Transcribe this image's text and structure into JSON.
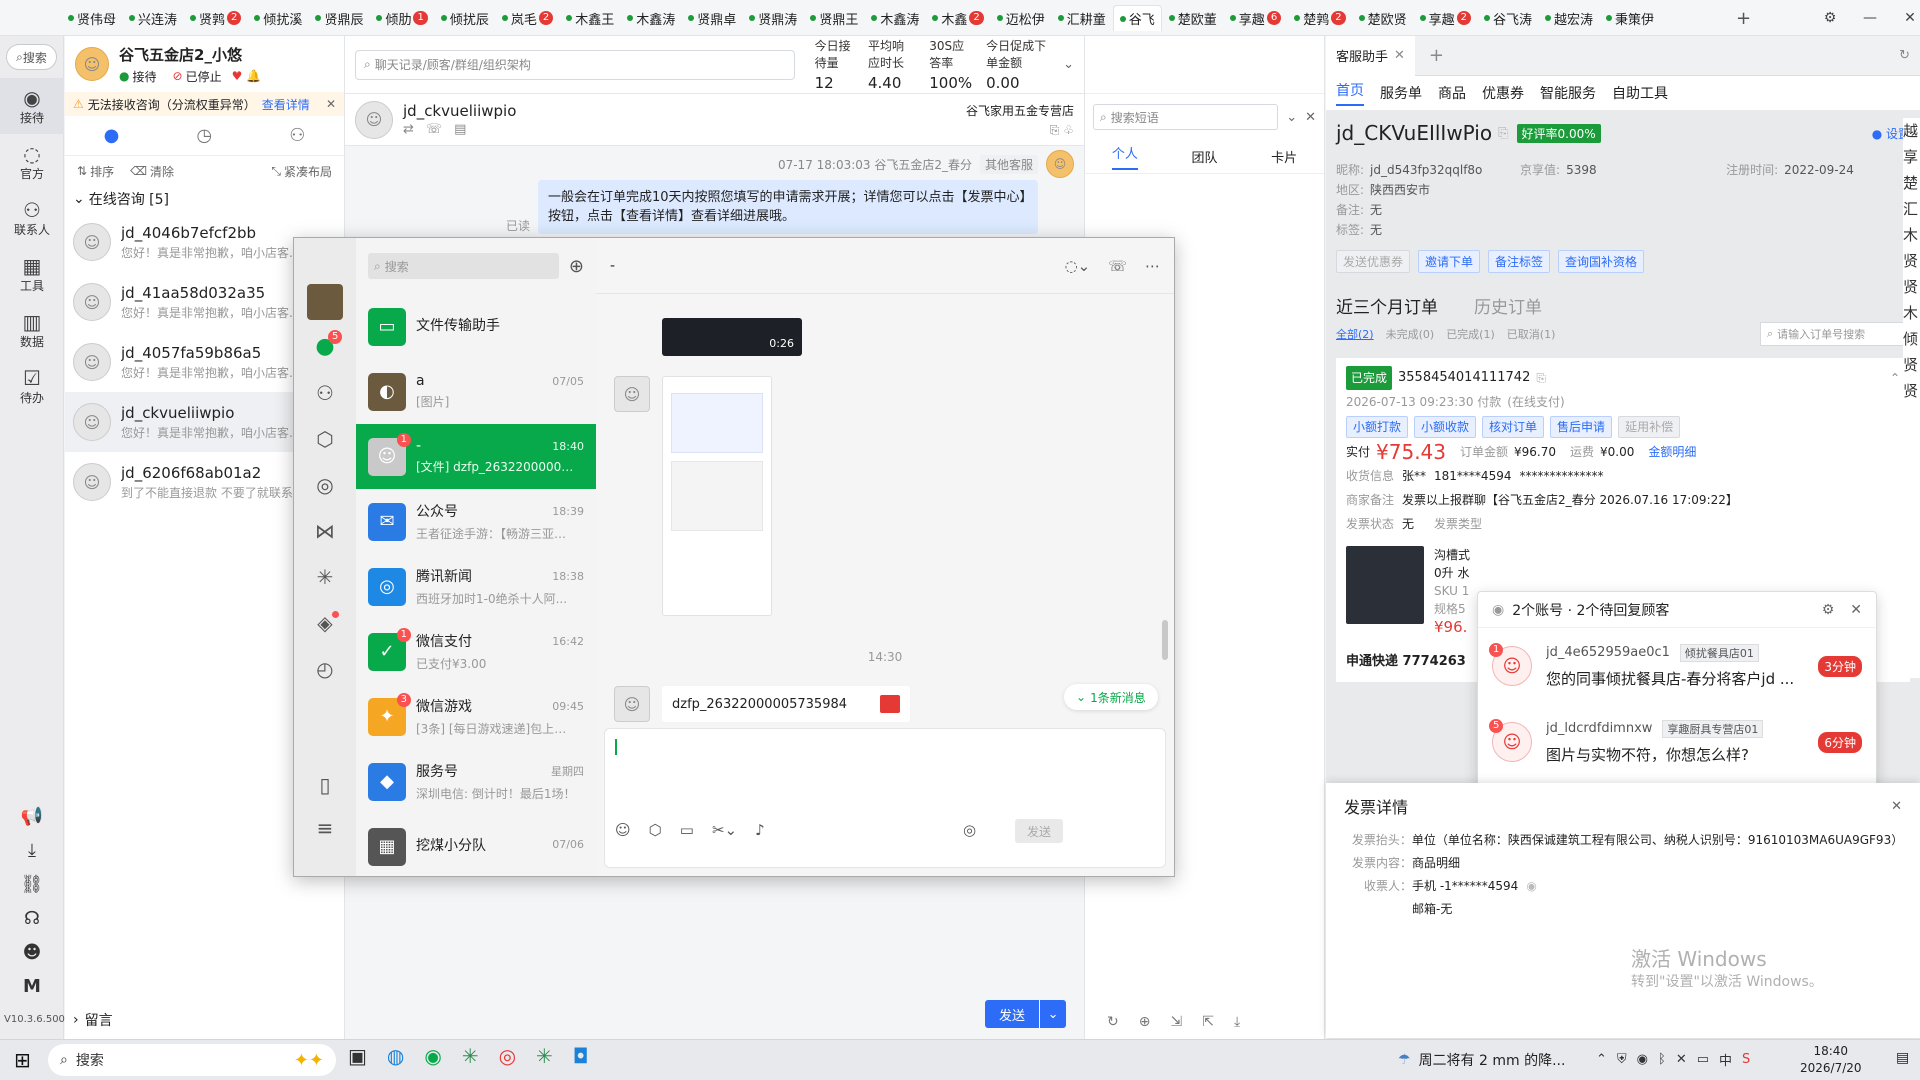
{
  "tabs": [
    {
      "label": "贤伟母",
      "badge": ""
    },
    {
      "label": "兴连涛",
      "badge": ""
    },
    {
      "label": "贤鹑",
      "badge": "2"
    },
    {
      "label": "倾扰溪",
      "badge": ""
    },
    {
      "label": "贤鼎辰",
      "badge": ""
    },
    {
      "label": "倾肋",
      "badge": "1"
    },
    {
      "label": "倾扰辰",
      "badge": ""
    },
    {
      "label": "岚毛",
      "badge": "2"
    },
    {
      "label": "木鑫王",
      "badge": ""
    },
    {
      "label": "木鑫涛",
      "badge": ""
    },
    {
      "label": "贤鼎卓",
      "badge": ""
    },
    {
      "label": "贤鼎涛",
      "badge": ""
    },
    {
      "label": "贤鼎王",
      "badge": ""
    },
    {
      "label": "木鑫涛",
      "badge": ""
    },
    {
      "label": "木鑫",
      "badge": "2"
    },
    {
      "label": "迈松伊",
      "badge": ""
    },
    {
      "label": "汇耕童",
      "badge": ""
    },
    {
      "label": "谷飞",
      "badge": "",
      "active": true
    },
    {
      "label": "楚欧董",
      "badge": ""
    },
    {
      "label": "享趣",
      "badge": "6"
    },
    {
      "label": "楚鹑",
      "badge": "2"
    },
    {
      "label": "楚欧贤",
      "badge": ""
    },
    {
      "label": "享趣",
      "badge": "2"
    },
    {
      "label": "谷飞涛",
      "badge": ""
    },
    {
      "label": "越宏涛",
      "badge": ""
    },
    {
      "label": "秉策伊",
      "badge": ""
    }
  ],
  "rail": {
    "search": "搜索",
    "items": [
      "接待",
      "官方",
      "联系人",
      "工具",
      "数据",
      "待办"
    ],
    "version": "V10.3.6.500"
  },
  "shop": {
    "name": "谷飞五金店2_小悠",
    "status_receive": "接待",
    "status_stop": "已停止",
    "alert": "无法接收咨询（分流权重异常）",
    "alert_link": "查看详情",
    "sort": "排序",
    "clear": "清除",
    "compact": "紧凑布局",
    "online_label": "在线咨询 [5]",
    "leave_msg": "留言"
  },
  "contacts": [
    {
      "name": "jd_4046b7efcf2bb",
      "preview": "您好！真是非常抱歉，咱小店客..."
    },
    {
      "name": "jd_41aa58d032a35",
      "preview": "您好！真是非常抱歉，咱小店客..."
    },
    {
      "name": "jd_4057fa59b86a5",
      "preview": "您好！真是非常抱歉，咱小店客..."
    },
    {
      "name": "jd_ckvueliiwpio",
      "preview": "您好！真是非常抱歉，咱小店客..."
    },
    {
      "name": "jd_6206f68ab01a2",
      "preview": "到了不能直接退款 不要了就联系..."
    }
  ],
  "chat": {
    "search_placeholder": "聊天记录/顾客/群组/组织架构",
    "stats": [
      {
        "label": "今日接待量",
        "value": "12"
      },
      {
        "label": "平均响应时长",
        "value": "4.40"
      },
      {
        "label": "30S应答率",
        "value": "100%"
      },
      {
        "label": "今日促成下单金额",
        "value": "0.00"
      }
    ],
    "customer": "jd_ckvueliiwpio",
    "store": "谷飞家用五金专营店",
    "msg_meta": "07-17 18:03:03  谷飞五金店2_春分",
    "msg_role": "其他客服",
    "msg_text": "一般会在订单完成10天内按照您填写的申请需求开展；详情您可以点击【发票中心】按钮，点击【查看详情】查看详细进展哦。",
    "msg_status": "已读",
    "send": "发送",
    "quick_search": "搜索短语",
    "quick_tabs": [
      "个人",
      "团队",
      "卡片"
    ]
  },
  "wx": {
    "search": "搜索",
    "chat_title": "-",
    "chats": [
      {
        "name": "文件传输助手",
        "time": "",
        "preview": "",
        "color": "#08a94a",
        "icon": "▭",
        "badge": ""
      },
      {
        "name": "a",
        "time": "07/05",
        "preview": "[图片]",
        "color": "#6b5a3e",
        "icon": "◐",
        "badge": ""
      },
      {
        "name": "-",
        "time": "18:40",
        "preview": "[文件] dzfp_2632200000583...",
        "color": "#c9c9c9",
        "icon": "☺",
        "badge": "1",
        "sel": true
      },
      {
        "name": "公众号",
        "time": "18:39",
        "preview": "王者征途手游：【畅游三亚】...",
        "color": "#2a7be4",
        "icon": "✉",
        "badge": ""
      },
      {
        "name": "腾讯新闻",
        "time": "18:38",
        "preview": "西班牙加时1-0绝杀十人阿...",
        "color": "#1e88e5",
        "icon": "◎",
        "badge": ""
      },
      {
        "name": "微信支付",
        "time": "16:42",
        "preview": "已支付¥3.00",
        "color": "#08a94a",
        "icon": "✓",
        "badge": "1"
      },
      {
        "name": "微信游戏",
        "time": "09:45",
        "preview": "[3条] [每日游戏速递]包上头的...",
        "color": "#f5a623",
        "icon": "✦",
        "badge": "3"
      },
      {
        "name": "服务号",
        "time": "星期四",
        "preview": "深圳电信: 倒计时！最后1场！",
        "color": "#2a7be4",
        "icon": "◆",
        "badge": ""
      },
      {
        "name": "挖煤小分队",
        "time": "07/06",
        "preview": "",
        "color": "#555",
        "icon": "▦",
        "badge": ""
      }
    ],
    "video_duration": "0:26",
    "time_sep": "14:30",
    "file_name": "dzfp_26322000005735984",
    "new_msg": "1条新消息",
    "send": "发送",
    "nav_badge": "5"
  },
  "helper": {
    "title": "客服助手",
    "nav": [
      "首页",
      "服务单",
      "商品",
      "优惠券",
      "智能服务",
      "自助工具"
    ],
    "customer_id": "jd_CKVuEIlIwPio",
    "rate": "好评率0.00%",
    "settings": "设置",
    "fields": [
      {
        "label": "昵称:",
        "value": "jd_d543fp32qqlf8o"
      },
      {
        "label": "京享值:",
        "value": "5398"
      },
      {
        "label": "注册时间:",
        "value": "2022-09-24"
      },
      {
        "label": "地区:",
        "value": "陕西西安市"
      },
      {
        "label": "备注:",
        "value": "无"
      },
      {
        "label": "标签:",
        "value": "无"
      }
    ],
    "actions": [
      "发送优惠券",
      "邀请下单",
      "备注标签",
      "查询国补资格"
    ],
    "order_tabs": [
      "近三个月订单",
      "历史订单"
    ],
    "order_filters": [
      "全部(2)",
      "未完成(0)",
      "已完成(1)",
      "已取消(1)"
    ],
    "order_search": "请输入订单号搜索",
    "order_status": "已完成",
    "order_no": "3558454014111742",
    "order_time": "2026-07-13 09:23:30 付款",
    "order_paytype": "(在线支付)",
    "order_buttons": [
      "小额打款",
      "小额收款",
      "核对订单",
      "售后申请",
      "延用补偿"
    ],
    "paid_label": "实付",
    "paid": "¥75.43",
    "total_label": "订单金额",
    "total": "¥96.70",
    "freight_label": "运费",
    "freight": "¥0.00",
    "detail_link": "金额明细",
    "receiver_label": "收货信息",
    "receiver": "张**",
    "phone": "181****4594",
    "masked": "**************",
    "note_label": "商家备注",
    "note": "发票以上报群聊【谷飞五金店2_春分 2026.07.16 17:09:22】",
    "invoice_status_label": "发票状态",
    "invoice_status": "无",
    "invoice_type_label": "发票类型",
    "product_name": "沟槽式",
    "product_stock": "0升 水",
    "product_sku": "SKU 1",
    "product_spec": "规格5",
    "product_price": "¥96.",
    "shipping": "申通快递 7774263"
  },
  "notif": {
    "title": "2个账号 · 2个待回复顾客",
    "items": [
      {
        "user": "jd_4e652959ae0c1",
        "shop": "倾扰餐具店01",
        "msg": "您的同事倾扰餐具店-春分将客户jd ...",
        "time": "3分钟",
        "badge": "1"
      },
      {
        "user": "jd_ldcrdfdimnxw",
        "shop": "享趣厨具专营店01",
        "msg": "图片与实物不符，你想怎么样?",
        "time": "6分钟",
        "badge": "5"
      }
    ]
  },
  "invoice": {
    "title": "发票详情",
    "rows": [
      {
        "label": "发票抬头：",
        "value": "单位（单位名称：陕西保诚建筑工程有限公司、纳税人识别号：91610103MA6UA9GF93）"
      },
      {
        "label": "发票内容：",
        "value": "商品明细"
      },
      {
        "label": "收票人：",
        "value": "手机 -1******4594"
      },
      {
        "label": "",
        "value": "邮箱-无"
      }
    ],
    "watermark1": "激活 Windows",
    "watermark2": "转到\"设置\"以激活 Windows。"
  },
  "side_strip": [
    "越",
    "享",
    "楚",
    "汇",
    "木",
    "贤",
    "贤",
    "木",
    "倾",
    "贤",
    "贤"
  ],
  "taskbar": {
    "search": "搜索",
    "weather": "周二将有 2 mm 的降...",
    "time": "18:40",
    "date": "2026/7/20",
    "ime": "中"
  }
}
